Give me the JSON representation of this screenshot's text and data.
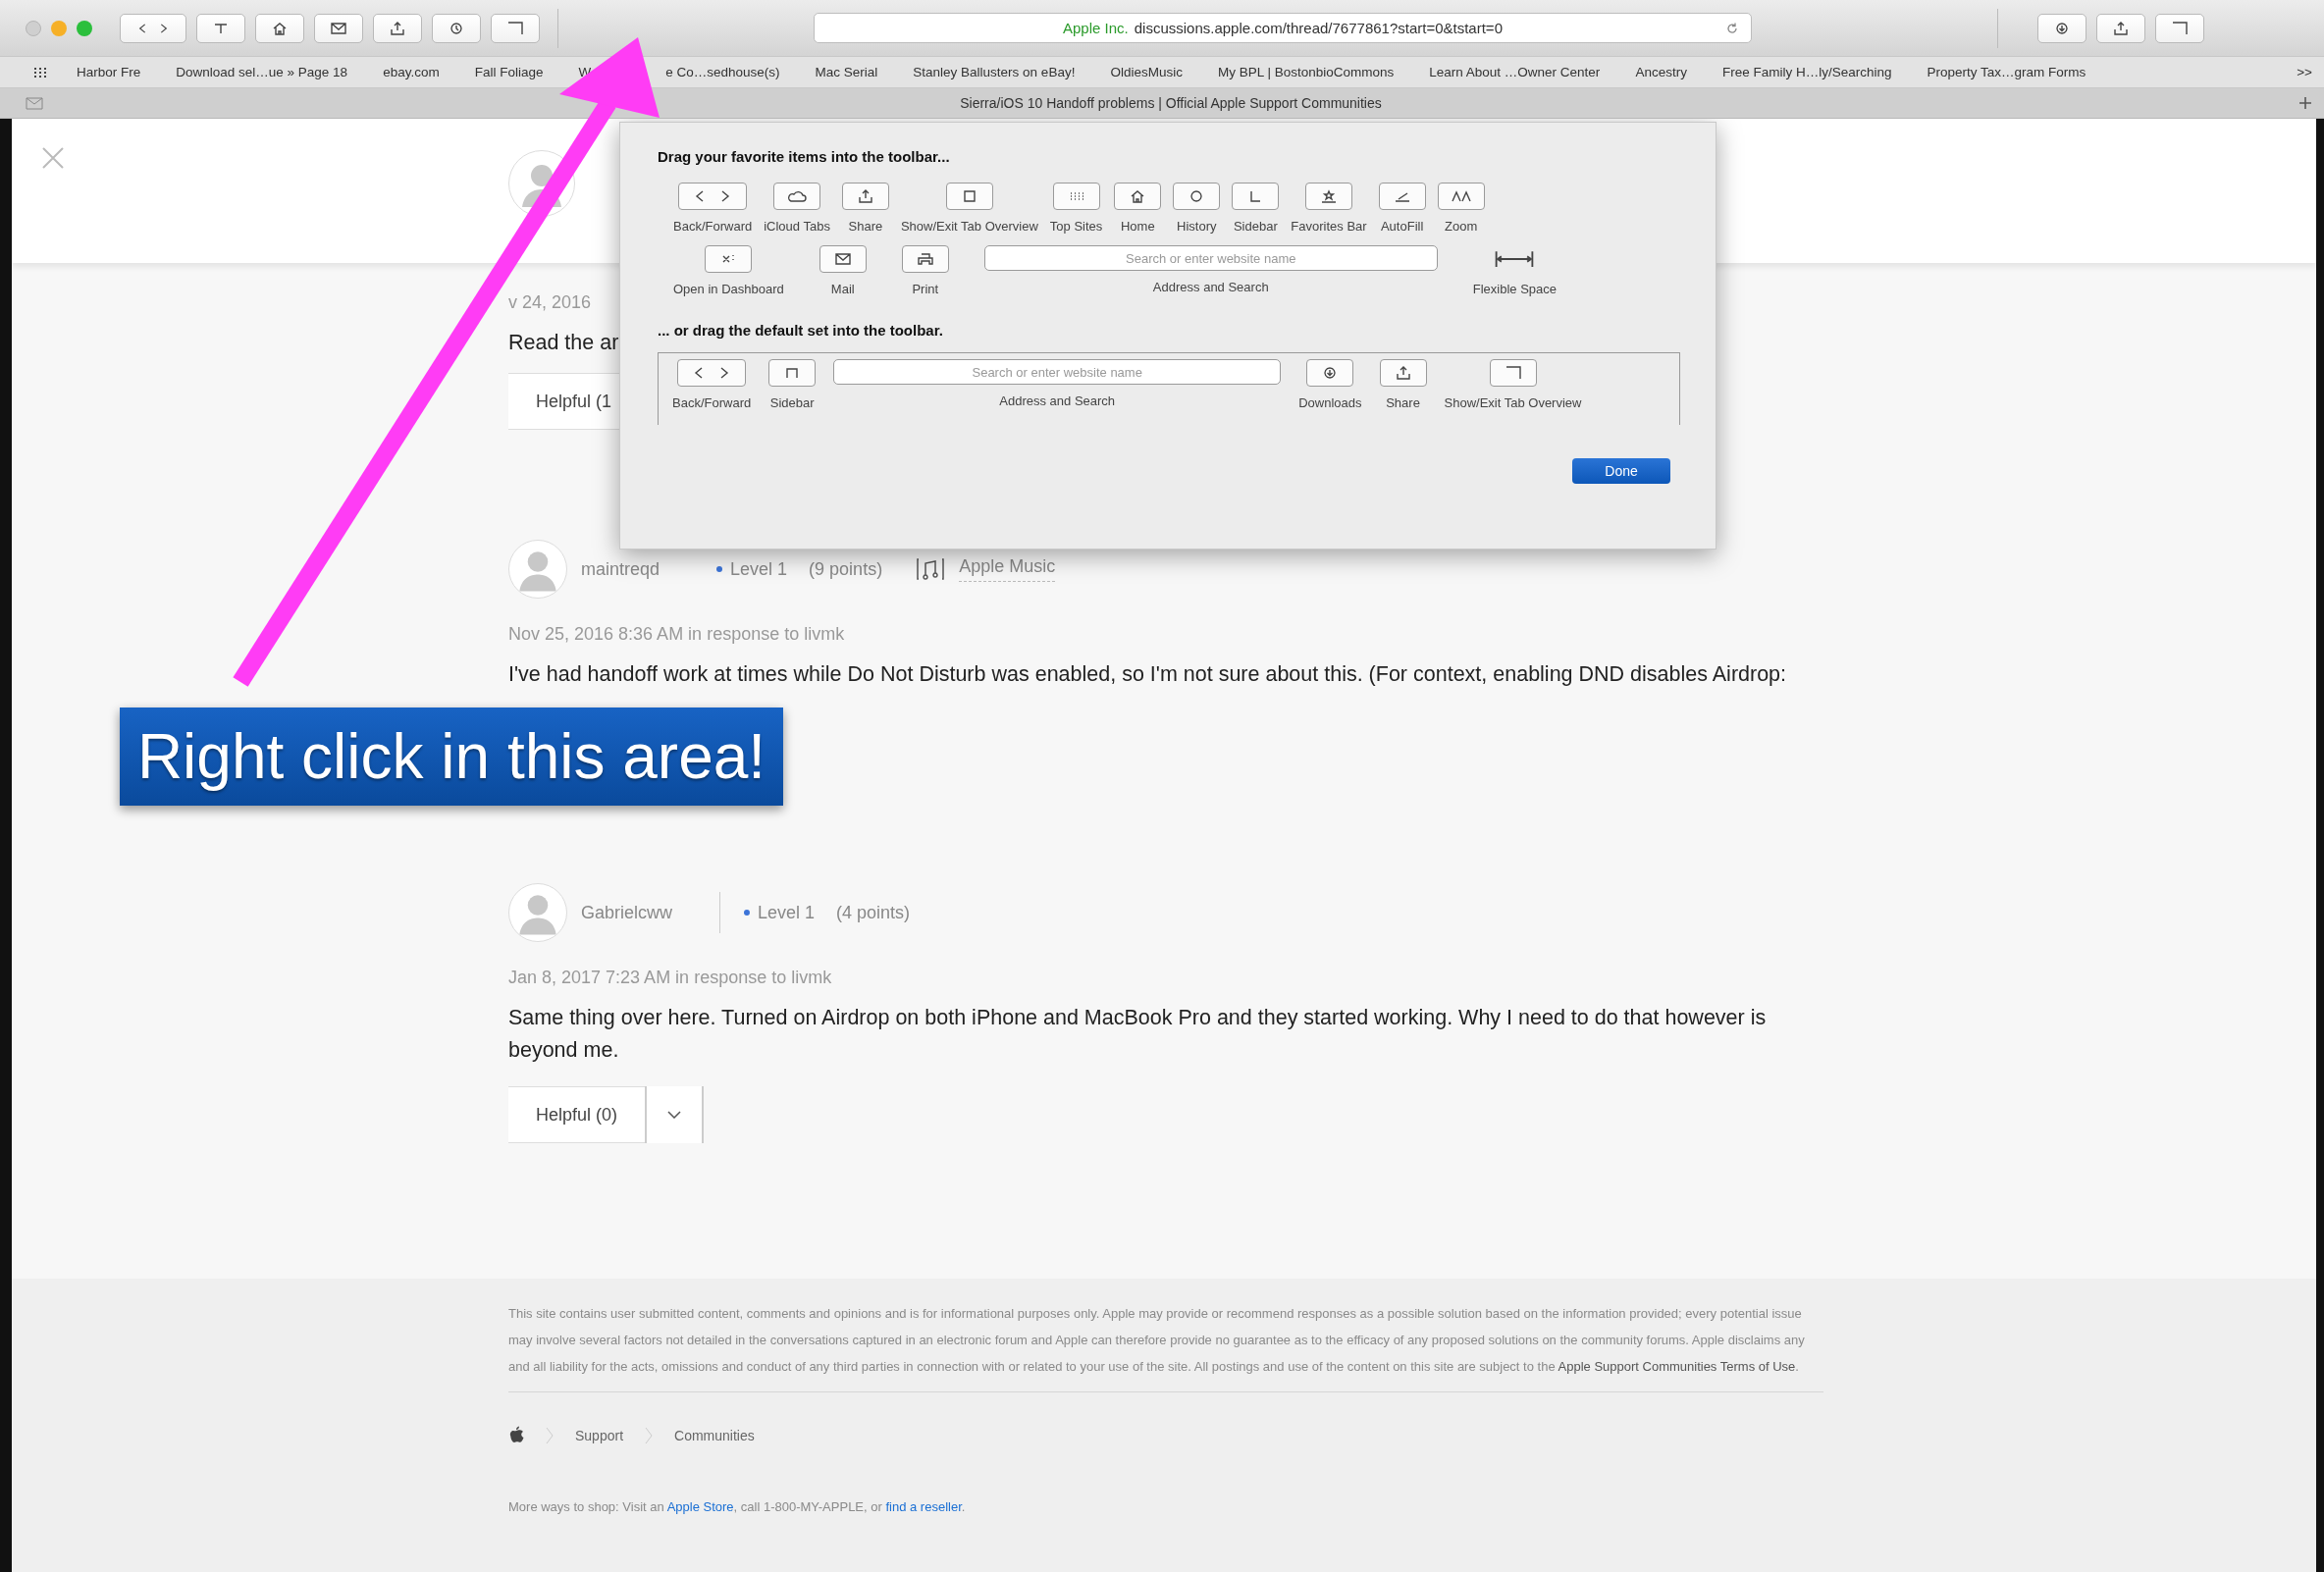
{
  "toolbar": {
    "address": {
      "owner": "Apple Inc.",
      "url": "discussions.apple.com/thread/7677861?start=0&tstart=0"
    }
  },
  "bookmarks": [
    "Harbor Fre",
    "Download sel…ue » Page 18",
    "ebay.com",
    "Fall Foliage",
    "W",
    "e Co…sedhouse(s)",
    "Mac Serial",
    "Stanley Ballusters on eBay!",
    "OldiesMusic",
    "My BPL | BostonbioCommons",
    "Learn About …Owner Center",
    "Ancestry",
    "Free Family H…ly/Searching",
    "Property Tax…gram Forms"
  ],
  "bookmarks_overflow": ">>",
  "tab": {
    "title": "Sierra/iOS 10 Handoff problems | Official Apple Support Communities"
  },
  "customize_dialog": {
    "heading": "Drag your favorite items into the toolbar...",
    "palette_rows": [
      [
        {
          "kind": "button",
          "label": "Back/Forward"
        },
        {
          "kind": "button",
          "label": "iCloud Tabs"
        },
        {
          "kind": "button",
          "label": "Share"
        },
        {
          "kind": "button",
          "label": "Show/Exit Tab Overview"
        },
        {
          "kind": "button",
          "label": "Top Sites"
        },
        {
          "kind": "button",
          "label": "Home"
        },
        {
          "kind": "button",
          "label": "History"
        },
        {
          "kind": "button",
          "label": "Sidebar"
        },
        {
          "kind": "button",
          "label": "Favorites Bar"
        },
        {
          "kind": "button",
          "label": "AutoFill"
        },
        {
          "kind": "button",
          "label": "Zoom"
        }
      ],
      [
        {
          "kind": "button",
          "label": "Open in Dashboard"
        },
        {
          "kind": "button",
          "label": "Mail"
        },
        {
          "kind": "button",
          "label": "Print"
        },
        {
          "kind": "field",
          "label": "Address and Search",
          "placeholder": "Search or enter website name"
        },
        {
          "kind": "space",
          "label": "Flexible Space"
        }
      ]
    ],
    "default_heading": "... or drag the default set into the toolbar.",
    "default_set": [
      {
        "kind": "button",
        "label": "Back/Forward"
      },
      {
        "kind": "button",
        "label": "Sidebar"
      },
      {
        "kind": "field",
        "label": "Address and Search",
        "placeholder": "Search or enter website name"
      },
      {
        "kind": "button",
        "label": "Downloads"
      },
      {
        "kind": "button",
        "label": "Share"
      },
      {
        "kind": "button",
        "label": "Show/Exit Tab Overview"
      }
    ],
    "done": "Done"
  },
  "posts": [
    {
      "date": "v 24, 2016",
      "body": "Read the ar",
      "helpful": "Helpful (1"
    },
    {
      "author": "maintreqd",
      "level": "Level 1",
      "points": "(9 points)",
      "badge": "Apple Music",
      "date": "Nov 25, 2016 8:36 AM in response to livmk",
      "body": "I've had handoff work at times while Do Not Disturb was enabled, so I'm not sure about this. (For context, enabling DND disables Airdrop:"
    },
    {
      "author": "Gabrielcww",
      "level": "Level 1",
      "points": "(4 points)",
      "date": "Jan 8, 2017 7:23 AM in response to livmk",
      "body": "Same thing over here. Turned on Airdrop on both iPhone and MacBook Pro and they started working. Why I need to do that however is beyond me.",
      "helpful": "Helpful (0)"
    }
  ],
  "annotation": {
    "text": "Right click in this area!"
  },
  "footer": {
    "disclaimer": "This site contains user submitted content, comments and opinions and is for informational purposes only. Apple may provide or recommend responses as a possible solution based on the information provided; every potential issue may involve several factors not detailed in the conversations captured in an electronic forum and Apple can therefore provide no guarantee as to the efficacy of any proposed solutions on the community forums. Apple disclaims any and all liability for the acts, omissions and conduct of any third parties in connection with or related to your use of the site. All postings and use of the content on this site are subject to the ",
    "terms_link": "Apple Support Communities Terms of Use",
    "disclaimer_end": ".",
    "breadcrumbs": [
      "Support",
      "Communities"
    ],
    "shop": {
      "before": "More ways to shop: Visit an ",
      "store_link": "Apple Store",
      "middle": ", call 1-800-MY-APPLE, or ",
      "reseller_link": "find a reseller",
      "end": "."
    }
  }
}
